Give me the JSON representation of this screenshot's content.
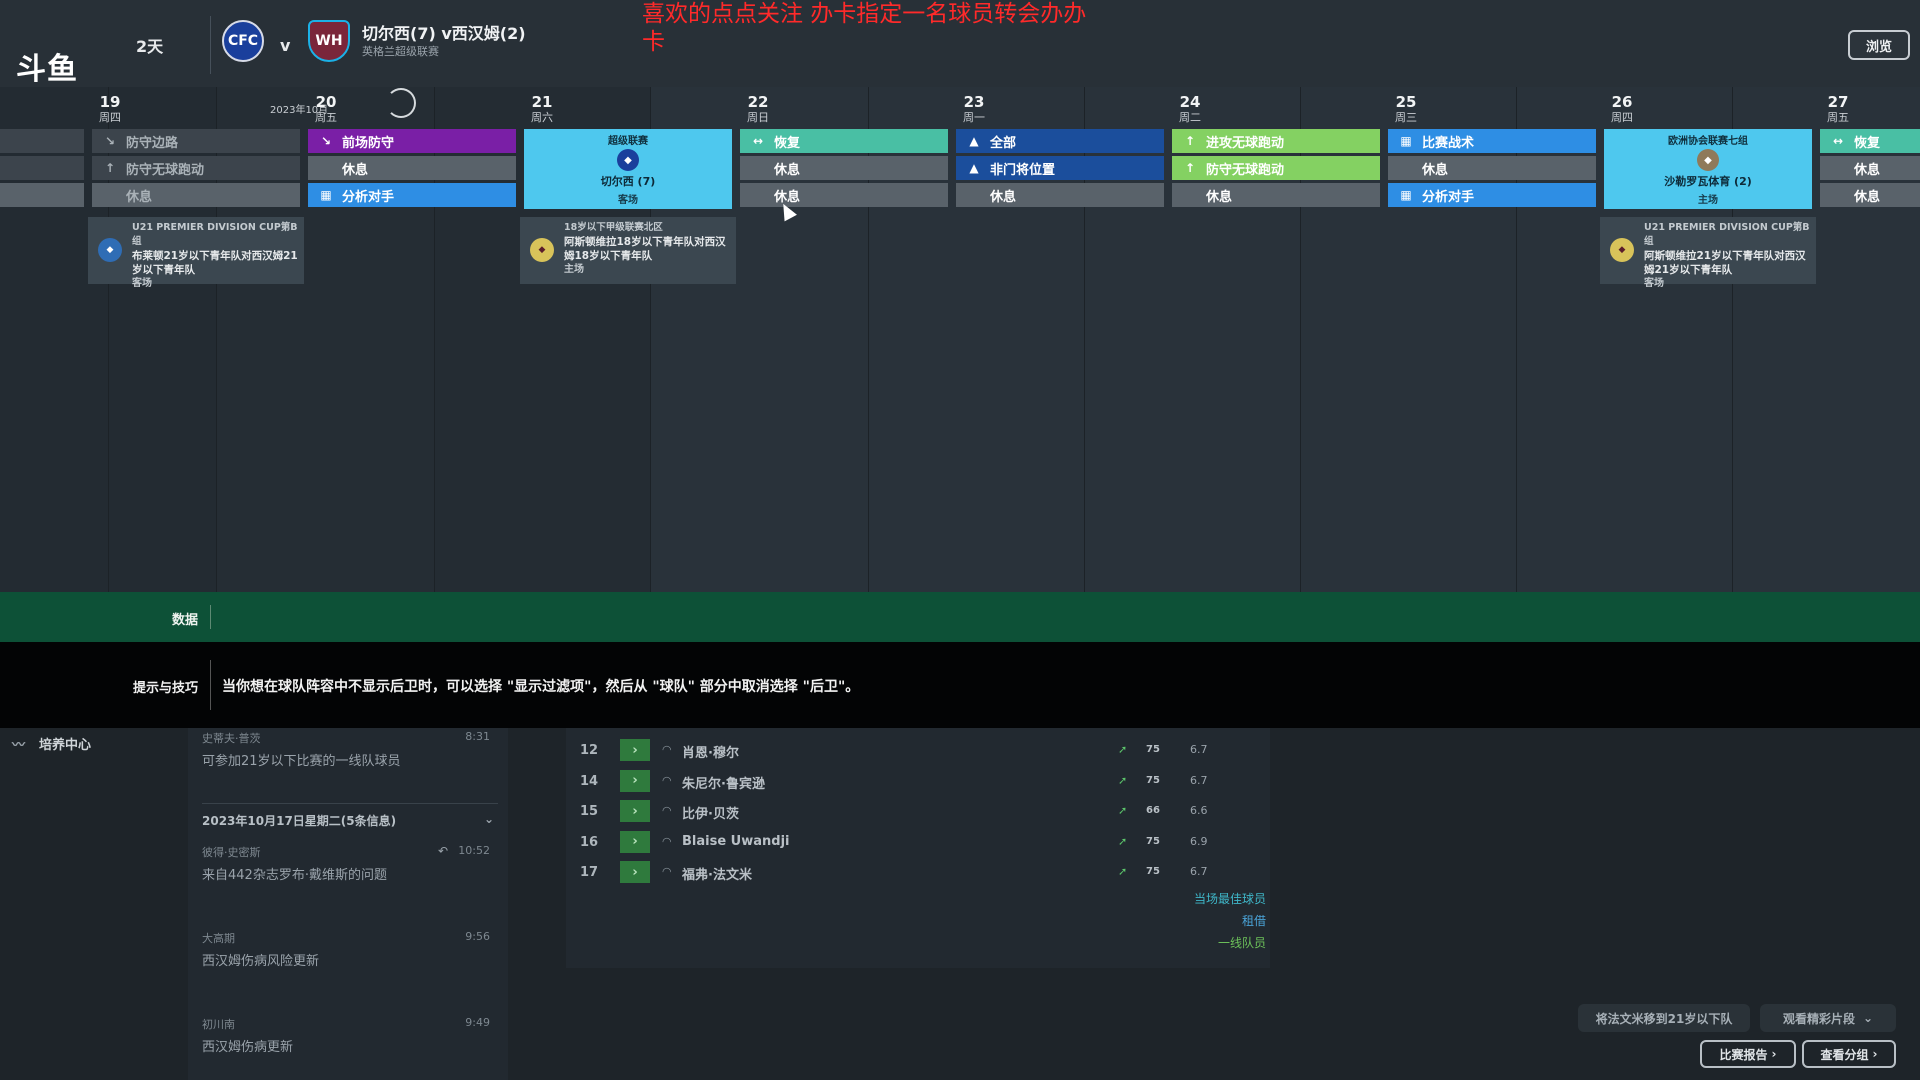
{
  "header": {
    "logo": "斗鱼",
    "days": "2天",
    "vs": "v",
    "match_title": "切尔西(7) v西汉姆(2)",
    "match_sub": "英格兰超级联赛",
    "overlay_text": "喜欢的点点关注  办卡指定一名球员转会办办卡",
    "browse_label": "浏览",
    "home_crest_icon": "chelsea-crest",
    "away_crest_icon": "west-ham-crest"
  },
  "calendar": {
    "month_label": "2023年10月",
    "days": [
      {
        "num": "19",
        "week": "周四"
      },
      {
        "num": "20",
        "week": "周五"
      },
      {
        "num": "21",
        "week": "周六"
      },
      {
        "num": "22",
        "week": "周日"
      },
      {
        "num": "23",
        "week": "周一"
      },
      {
        "num": "24",
        "week": "周二"
      },
      {
        "num": "25",
        "week": "周三"
      },
      {
        "num": "26",
        "week": "周四"
      },
      {
        "num": "27",
        "week": "周五"
      }
    ],
    "sessions": {
      "d19": [
        "防守边路",
        "防守无球跑动",
        "休息"
      ],
      "d20": [
        "前场防守",
        "休息",
        "分析对手"
      ],
      "d22": [
        "恢复",
        "休息",
        "休息"
      ],
      "d23": [
        "全部",
        "非门将位置",
        "休息"
      ],
      "d24": [
        "进攻无球跑动",
        "防守无球跑动",
        "休息"
      ],
      "d25": [
        "比赛战术",
        "休息",
        "分析对手"
      ],
      "d27": [
        "恢复",
        "休息",
        "休息"
      ]
    },
    "match21": {
      "comp": "超级联赛",
      "name": "切尔西 (7)",
      "venue": "客场"
    },
    "match26": {
      "comp": "欧洲协会联赛七组",
      "name": "沙勒罗瓦体育 (2)",
      "venue": "主场"
    },
    "youth": [
      {
        "comp": "U21 PREMIER DIVISION CUP第B组",
        "title": "布莱顿21岁以下青年队对西汉姆21岁以下青年队",
        "venue": "客场"
      },
      {
        "comp": "18岁以下甲级联赛北区",
        "title": "阿斯顿维拉18岁以下青年队对西汉姆18岁以下青年队",
        "venue": "主场"
      },
      {
        "comp": "U21 PREMIER DIVISION CUP第B组",
        "title": "阿斯顿维拉21岁以下青年队对西汉姆21岁以下青年队",
        "venue": "客场"
      }
    ],
    "colors": {
      "purple": "#7a1fa6",
      "blue": "#2e8ee4",
      "teal": "#49bfa4",
      "navy": "#1b4e9c",
      "green": "#84d162",
      "grey": "#59626a",
      "dark": "#3c444c",
      "cyan": "#4ec8ee"
    }
  },
  "data_bar": {
    "label": "数据"
  },
  "tips": {
    "label": "提示与技巧",
    "text": "当你想在球队阵容中不显示后卫时，可以选择 \"显示过滤项\"，然后从 \"球队\" 部分中取消选择 \"后卫\"。"
  },
  "nav": {
    "dev_center": "培养中心"
  },
  "news": {
    "top_item": {
      "src": "史蒂夫·普茨",
      "title": "可参加21岁以下比赛的一线队球员",
      "time": "8:31"
    },
    "date_header": "2023年10月17日星期二(5条信息)",
    "items": [
      {
        "src": "彼得·史密斯",
        "title": "来自442杂志罗布·戴维斯的问题",
        "time": "10:52"
      },
      {
        "src": "大高期",
        "title": "西汉姆伤病风险更新",
        "time": "9:56"
      },
      {
        "src": "初川南",
        "title": "西汉姆伤病更新",
        "time": "9:49"
      }
    ]
  },
  "players": [
    {
      "num": "12",
      "name": "肖恩·穆尔",
      "cond": "75",
      "rating": "6.7"
    },
    {
      "num": "14",
      "name": "朱尼尔·鲁宾逊",
      "cond": "75",
      "rating": "6.7"
    },
    {
      "num": "15",
      "name": "比伊·贝茨",
      "cond": "66",
      "rating": "6.6"
    },
    {
      "num": "16",
      "name": "Blaise Uwandji",
      "cond": "75",
      "rating": "6.9"
    },
    {
      "num": "17",
      "name": "福弗·法文米",
      "cond": "75",
      "rating": "6.7"
    }
  ],
  "legend": {
    "best": "当场最佳球员",
    "loan": "租借",
    "first_team": "一线队员"
  },
  "actions": {
    "move_u21": "将法文米移到21岁以下队",
    "highlights": "观看精彩片段",
    "report": "比赛报告",
    "groups": "查看分组"
  }
}
